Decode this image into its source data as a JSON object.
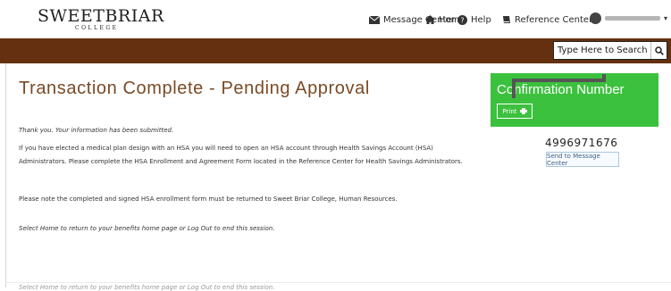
{
  "header": {
    "logo_text": "SWEETBRIAR",
    "logo_sub": "COLLEGE",
    "nav": {
      "home": "Home",
      "message_center": "Message Center",
      "help": "Help",
      "reference_center": "Reference Center"
    }
  },
  "search": {
    "placeholder": "Type Here to Search"
  },
  "main": {
    "title": "Transaction Complete - Pending Approval",
    "thank_you": "Thank you. Your information has been submitted.",
    "hsa_line1": "If you have elected a medical plan design with an HSA you will need to open an HSA account through Health Savings Account (HSA)",
    "hsa_line2": "Administrators. Please complete the HSA Enrollment and Agreement Form located in the Reference Center for Health Savings Administrators.",
    "return_note": "Please note the completed and signed HSA enrollment form must be returned to Sweet Briar College, Human Resources.",
    "select_home": "Select Home to return to your benefits home page or Log Out to end this session.",
    "select_home_repeat": "Select Home to return to your benefits home page or Log Out to end this session."
  },
  "confirmation": {
    "title": "Confirmation Number",
    "print_label": "Print",
    "number": "4996971676",
    "send_label": "Send to Message Center"
  },
  "colors": {
    "brand_bar": "#64300f",
    "title_brown": "#7b4a25",
    "confirm_green": "#3cc13e"
  }
}
